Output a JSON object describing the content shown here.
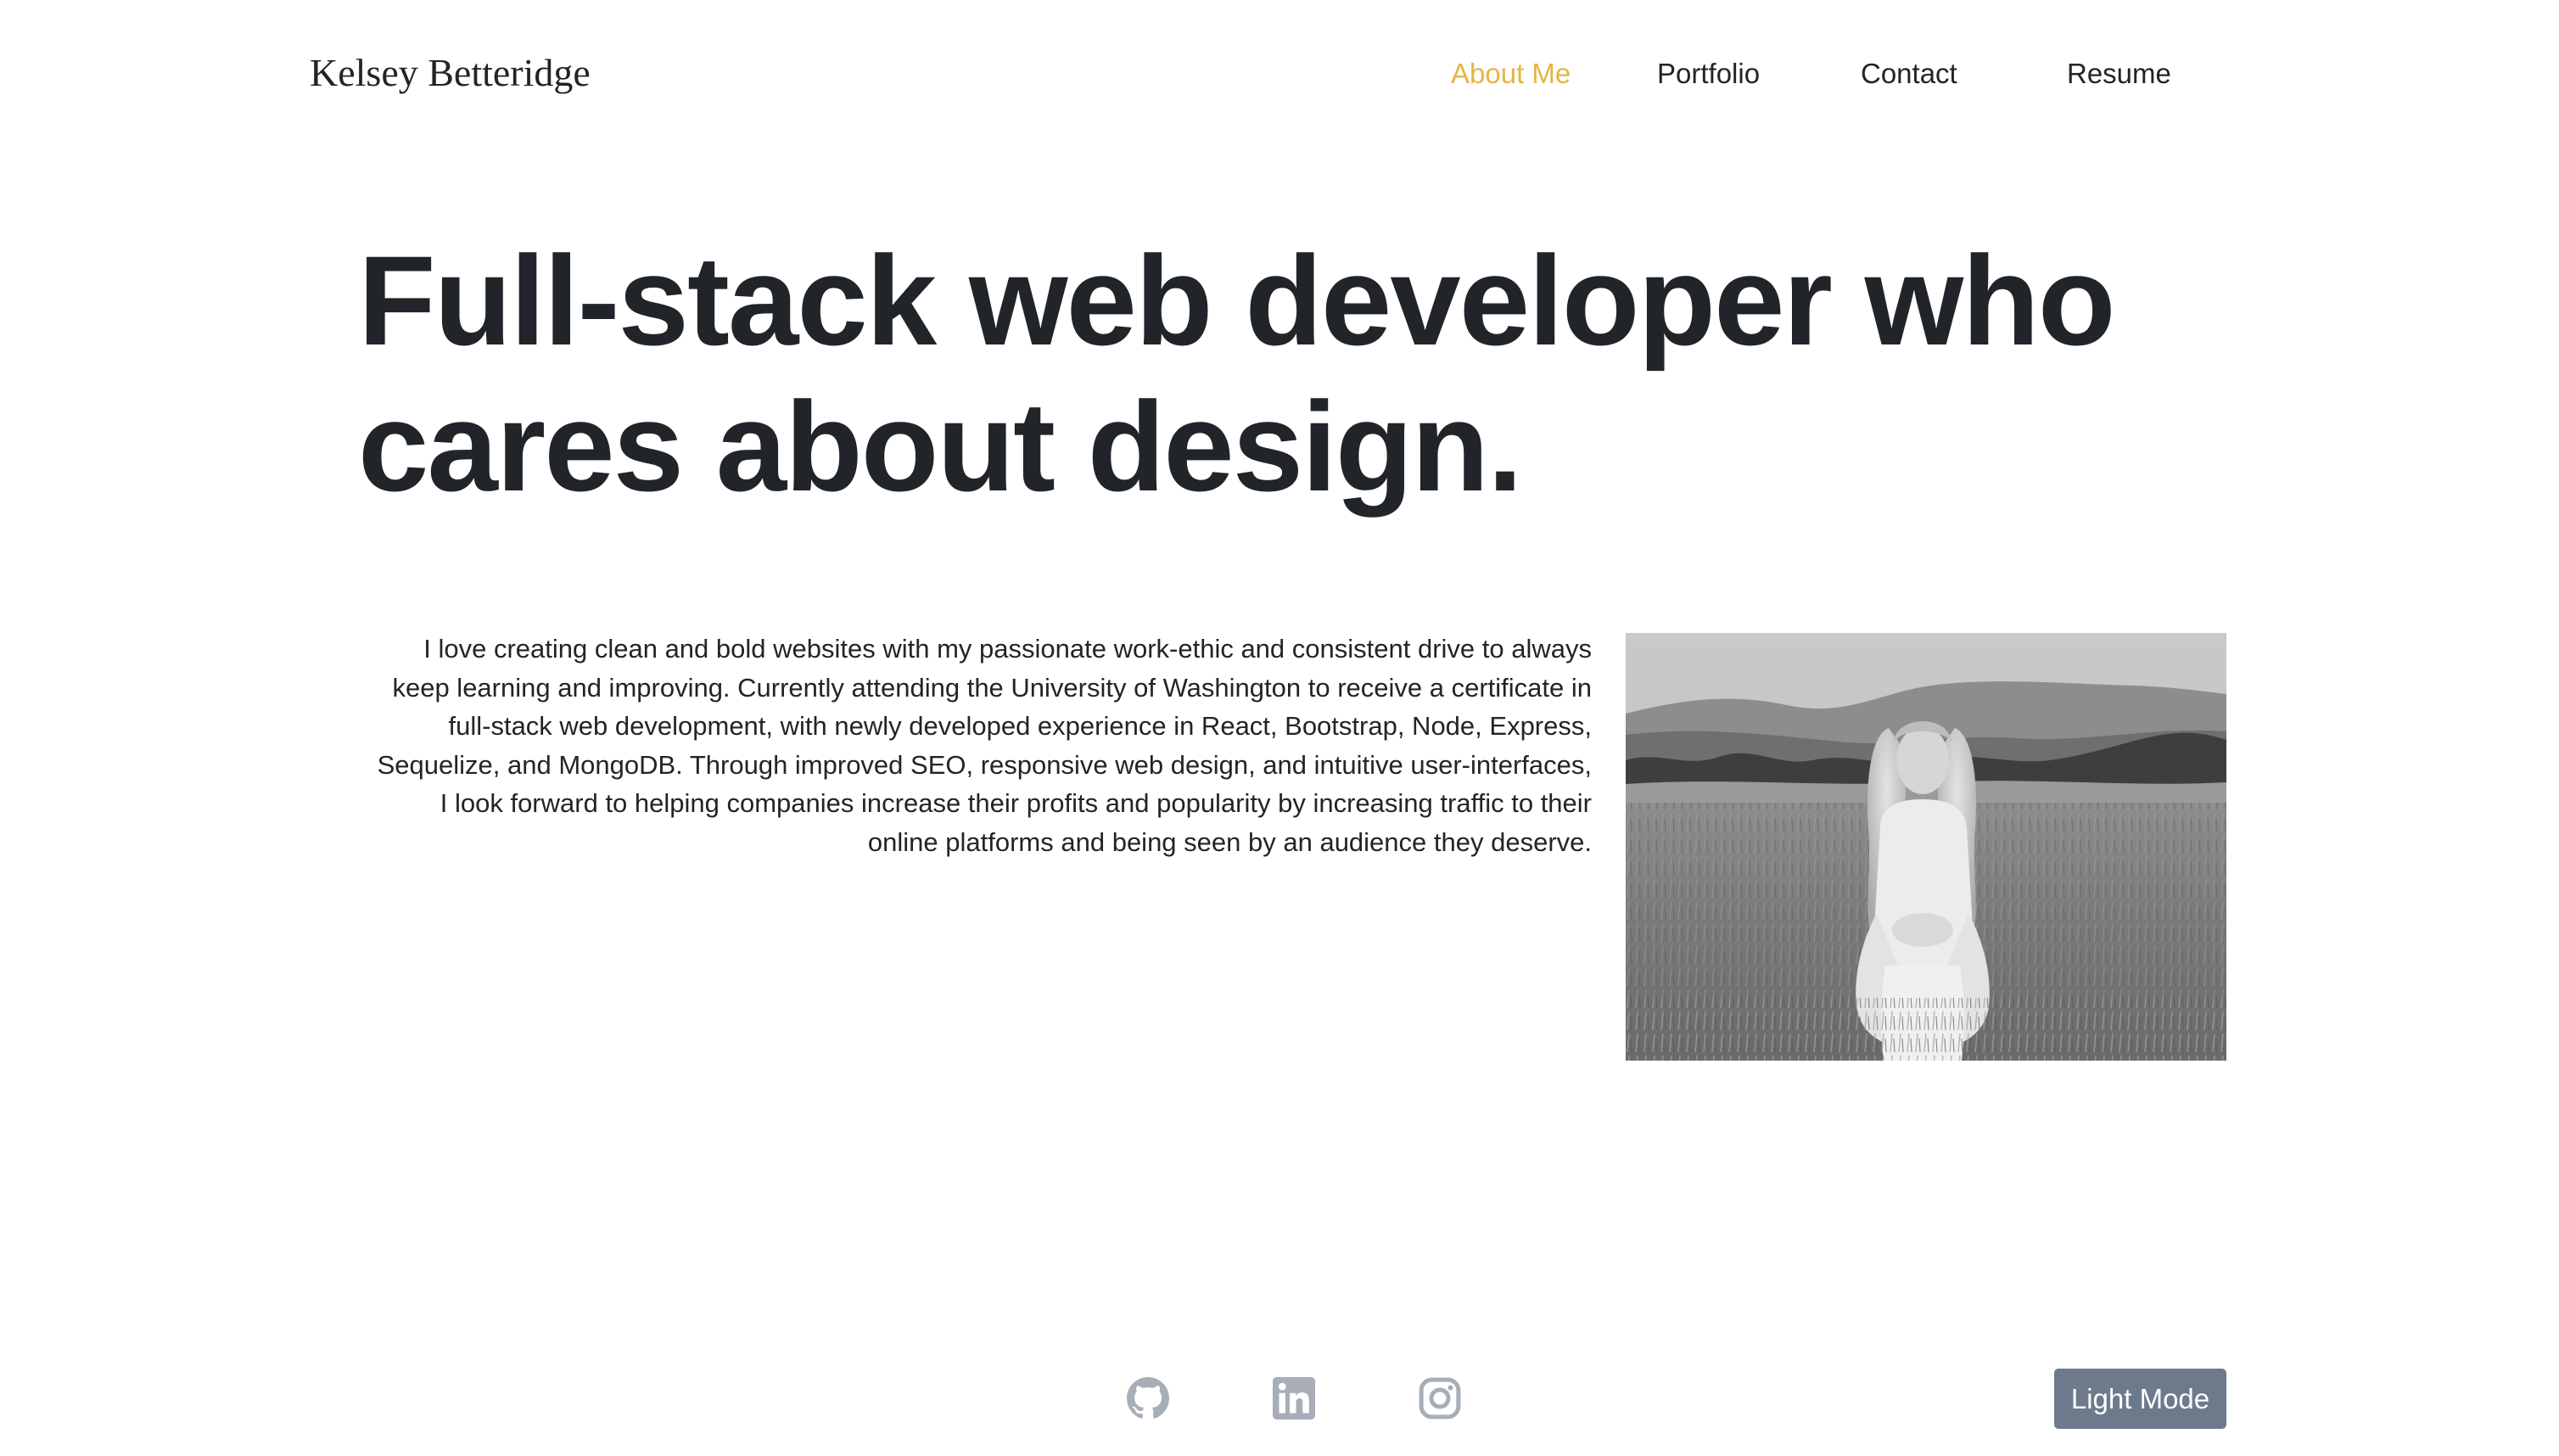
{
  "header": {
    "brand": "Kelsey Betteridge",
    "nav": [
      {
        "label": "About Me",
        "active": true
      },
      {
        "label": "Portfolio",
        "active": false
      },
      {
        "label": "Contact",
        "active": false
      },
      {
        "label": "Resume",
        "active": false
      }
    ]
  },
  "hero": {
    "line1": "Full-stack web developer who",
    "line2": "cares about design."
  },
  "about": {
    "bio": "I love creating clean and bold websites with my passionate work-ethic and consistent drive to always keep learning and improving. Currently attending the University of Washington to receive a certificate in full-stack web development, with newly developed experience in React, Bootstrap, Node, Express, Sequelize, and MongoDB. Through improved SEO, responsive web design, and intuitive user-interfaces, I look forward to helping companies increase their profits and popularity by increasing traffic to their online platforms and being seen by an audience they deserve.",
    "photo_icon": "profile-photo"
  },
  "footer": {
    "social": [
      {
        "icon": "github-icon"
      },
      {
        "icon": "linkedin-icon"
      },
      {
        "icon": "instagram-icon"
      }
    ],
    "mode_button": "Light Mode"
  },
  "colors": {
    "accent": "#e5b544",
    "text": "#212529",
    "icon": "#a7aeb8",
    "button": "#6c7a8b"
  }
}
